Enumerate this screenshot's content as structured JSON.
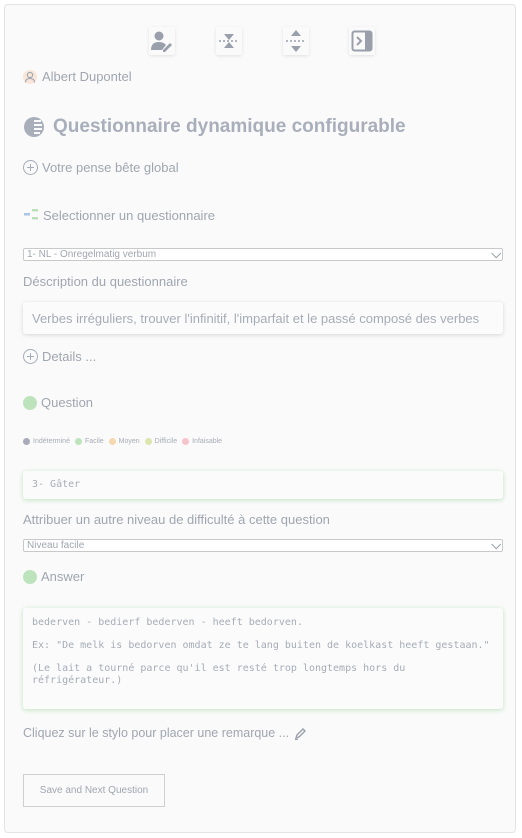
{
  "user": {
    "name": "Albert Dupontel"
  },
  "header": {
    "title": "Questionnaire dynamique configurable"
  },
  "memo": {
    "label": "Votre pense bête global"
  },
  "select_questionnaire": {
    "label": "Selectionner un questionnaire",
    "value": "1- NL - Onregelmatig verbum"
  },
  "description": {
    "label": "Déscription du questionnaire",
    "text": "Verbes irréguliers, trouver l'infinitif, l'imparfait et le passé composé des verbes"
  },
  "details": {
    "label": "Details ..."
  },
  "question": {
    "label": "Question",
    "legend": [
      {
        "label": "Indéterminé",
        "color": "#a9abb8"
      },
      {
        "label": "Facile",
        "color": "#bde3bd"
      },
      {
        "label": "Moyen",
        "color": "#f5d8ad"
      },
      {
        "label": "Difficile",
        "color": "#dde4b0"
      },
      {
        "label": "Infaisable",
        "color": "#f5c3c9"
      }
    ],
    "text": "3- Gâter"
  },
  "difficulty": {
    "label": "Attribuer un autre niveau de difficulté à cette question",
    "value": "Niveau facile"
  },
  "answer": {
    "label": "Answer",
    "text": "bederven - bedierf bederven - heeft bedorven.\n\nEx: \"De melk is bedorven omdat ze te lang buiten de koelkast heeft gestaan.\"\n\n(Le lait a tourné parce qu'il est resté trop longtemps hors du réfrigérateur.)"
  },
  "remark": {
    "label": "Cliquez sur le stylo pour placer une remarque ..."
  },
  "actions": {
    "save_next": "Save and Next Question"
  },
  "toolbar": {
    "icons": [
      "user-edit-icon",
      "collapse-vertical-icon",
      "expand-vertical-icon",
      "sidebar-toggle-icon"
    ]
  }
}
